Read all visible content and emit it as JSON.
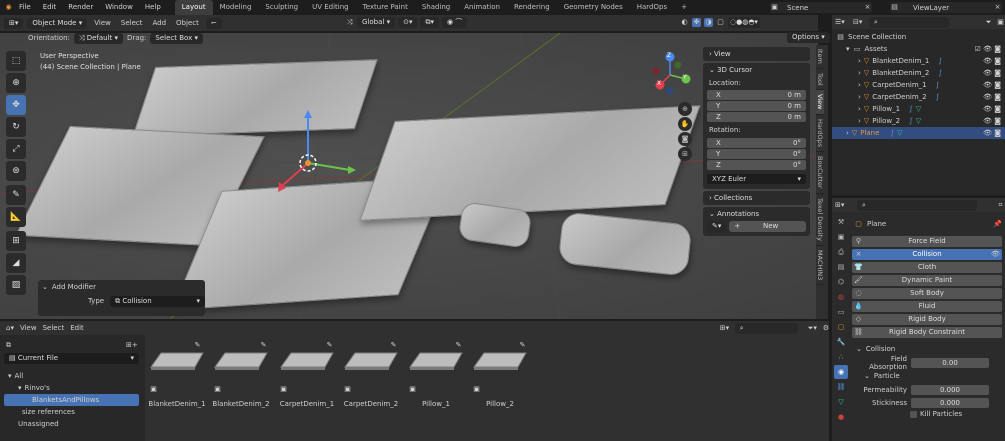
{
  "menu": [
    "File",
    "Edit",
    "Render",
    "Window",
    "Help"
  ],
  "workspaces": [
    "Layout",
    "Modeling",
    "Sculpting",
    "UV Editing",
    "Texture Paint",
    "Shading",
    "Animation",
    "Rendering",
    "Geometry Nodes",
    "HardOps"
  ],
  "workspaces_active": "Layout",
  "workspaces_plus": "+",
  "scene_label": "Scene",
  "view_layer_label": "ViewLayer",
  "vp_header": {
    "mode": "Object Mode",
    "menus": [
      "View",
      "Select",
      "Add",
      "Object"
    ],
    "transform": "Global"
  },
  "orient": {
    "orientation_label": "Orientation:",
    "orientation_value": "Default",
    "drag_label": "Drag:",
    "drag_value": "Select Box",
    "options": "Options"
  },
  "viewport": {
    "line1": "User Perspective",
    "line2": "(44) Scene Collection | Plane"
  },
  "gizmo": {
    "x": "X",
    "y": "Y",
    "z": "Z"
  },
  "npanel": {
    "view": "View",
    "cursor": "3D Cursor",
    "location": "Location:",
    "loc": [
      {
        "axis": "X",
        "val": "0 m"
      },
      {
        "axis": "Y",
        "val": "0 m"
      },
      {
        "axis": "Z",
        "val": "0 m"
      }
    ],
    "rotation": "Rotation:",
    "rot": [
      {
        "axis": "X",
        "val": "0°"
      },
      {
        "axis": "Y",
        "val": "0°"
      },
      {
        "axis": "Z",
        "val": "0°"
      }
    ],
    "euler": "XYZ Euler",
    "collections": "Collections",
    "annotations": "Annotations",
    "new": "New"
  },
  "side_tabs": [
    "Item",
    "Tool",
    "View",
    "HardOps",
    "BoxCutter",
    "Texel Density",
    "MACHIN3"
  ],
  "add_modifier": {
    "title": "Add Modifier",
    "type_label": "Type",
    "type_value": "Collision"
  },
  "outliner": {
    "root": "Scene Collection",
    "collection": "Assets",
    "items": [
      "BlanketDenim_1",
      "BlanketDenim_2",
      "CarpetDenim_1",
      "CarpetDenim_2",
      "Pillow_1",
      "Pillow_2"
    ],
    "plane": "Plane"
  },
  "props": {
    "object": "Plane",
    "buttons": [
      "Force Field",
      "Collision",
      "Cloth",
      "Dynamic Paint",
      "Soft Body",
      "Fluid",
      "Rigid Body",
      "Rigid Body Constraint"
    ],
    "section": "Collision",
    "absorption_label": "Field Absorption",
    "absorption_value": "0.00",
    "particle": "Particle",
    "perm_label": "Permeability",
    "perm_value": "0.000",
    "stick_label": "Stickiness",
    "stick_value": "0.000",
    "kill": "Kill Particles"
  },
  "asset_browser": {
    "menus": [
      "View",
      "Select",
      "Edit"
    ],
    "library": "Current File",
    "tree": [
      "All",
      "Rinvo's",
      "BlanketsAndPillows",
      "size references",
      "Unassigned"
    ],
    "assets": [
      "BlanketDenim_1",
      "BlanketDenim_2",
      "CarpetDenim_1",
      "CarpetDenim_2",
      "Pillow_1",
      "Pillow_2"
    ]
  }
}
